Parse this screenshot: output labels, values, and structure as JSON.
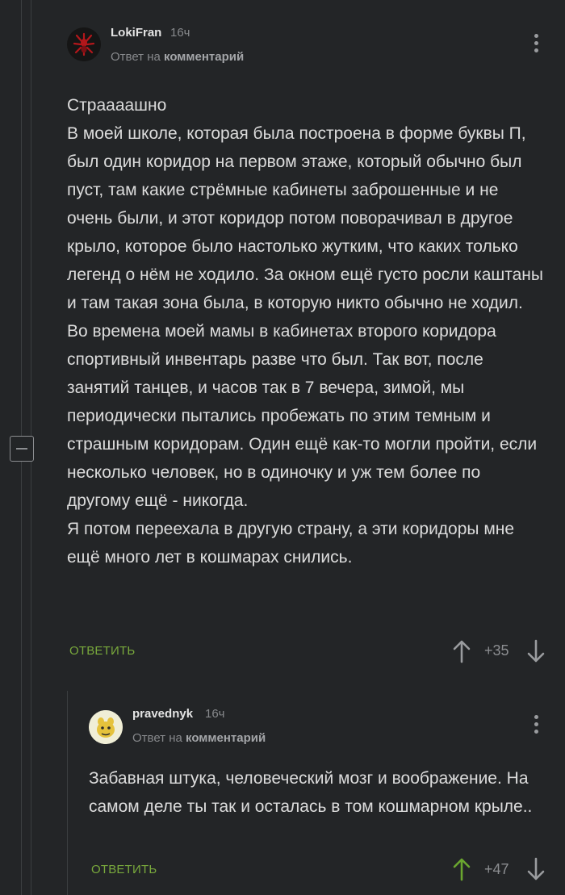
{
  "comments": [
    {
      "username": "LokiFran",
      "time": "16ч",
      "reply_prefix": "Ответ на",
      "reply_target": "комментарий",
      "paragraphs": [
        "Страааашно",
        "В моей школе, которая была построена в форме буквы П, был один коридор на первом этаже, который обычно был пуст, там какие стрёмные кабинеты заброшенные и не очень были, и этот коридор потом поворачивал в другое крыло, которое было настолько жутким, что каких только легенд о нём не ходило. За окном ещё густо росли каштаны и там такая зона была, в которую никто обычно не ходил. Во времена моей мамы в кабинетах второго коридора спортивный инвентарь разве что был. Так вот, после занятий танцев, и часов так в 7 вечера, зимой, мы периодически пытались пробежать по этим темным и страшным коридорам. Один ещё как-то могли пройти, если несколько человек, но в одиночку и уж тем более по другому ещё - никогда.",
        "Я потом переехала в другую страну, а эти коридоры мне ещё много лет в кошмарах снились."
      ],
      "reply_label": "ОТВЕТИТЬ",
      "score": "+35",
      "upvoted": false
    },
    {
      "username": "pravednyk",
      "time": "16ч",
      "reply_prefix": "Ответ на",
      "reply_target": "комментарий",
      "paragraphs": [
        "Забавная штука, человеческий мозг и воображение. На самом деле ты так и осталась в том кошмарном крыле.."
      ],
      "reply_label": "ОТВЕТИТЬ",
      "score": "+47",
      "upvoted": true
    }
  ],
  "colors": {
    "background": "#232527",
    "text": "#dcdcdc",
    "muted": "#87898c",
    "accent_green": "#79a93c",
    "thread_line": "#3b3e40"
  },
  "icons": [
    "collapse-icon",
    "more-options-icon",
    "upvote-arrow-icon",
    "downvote-arrow-icon"
  ]
}
